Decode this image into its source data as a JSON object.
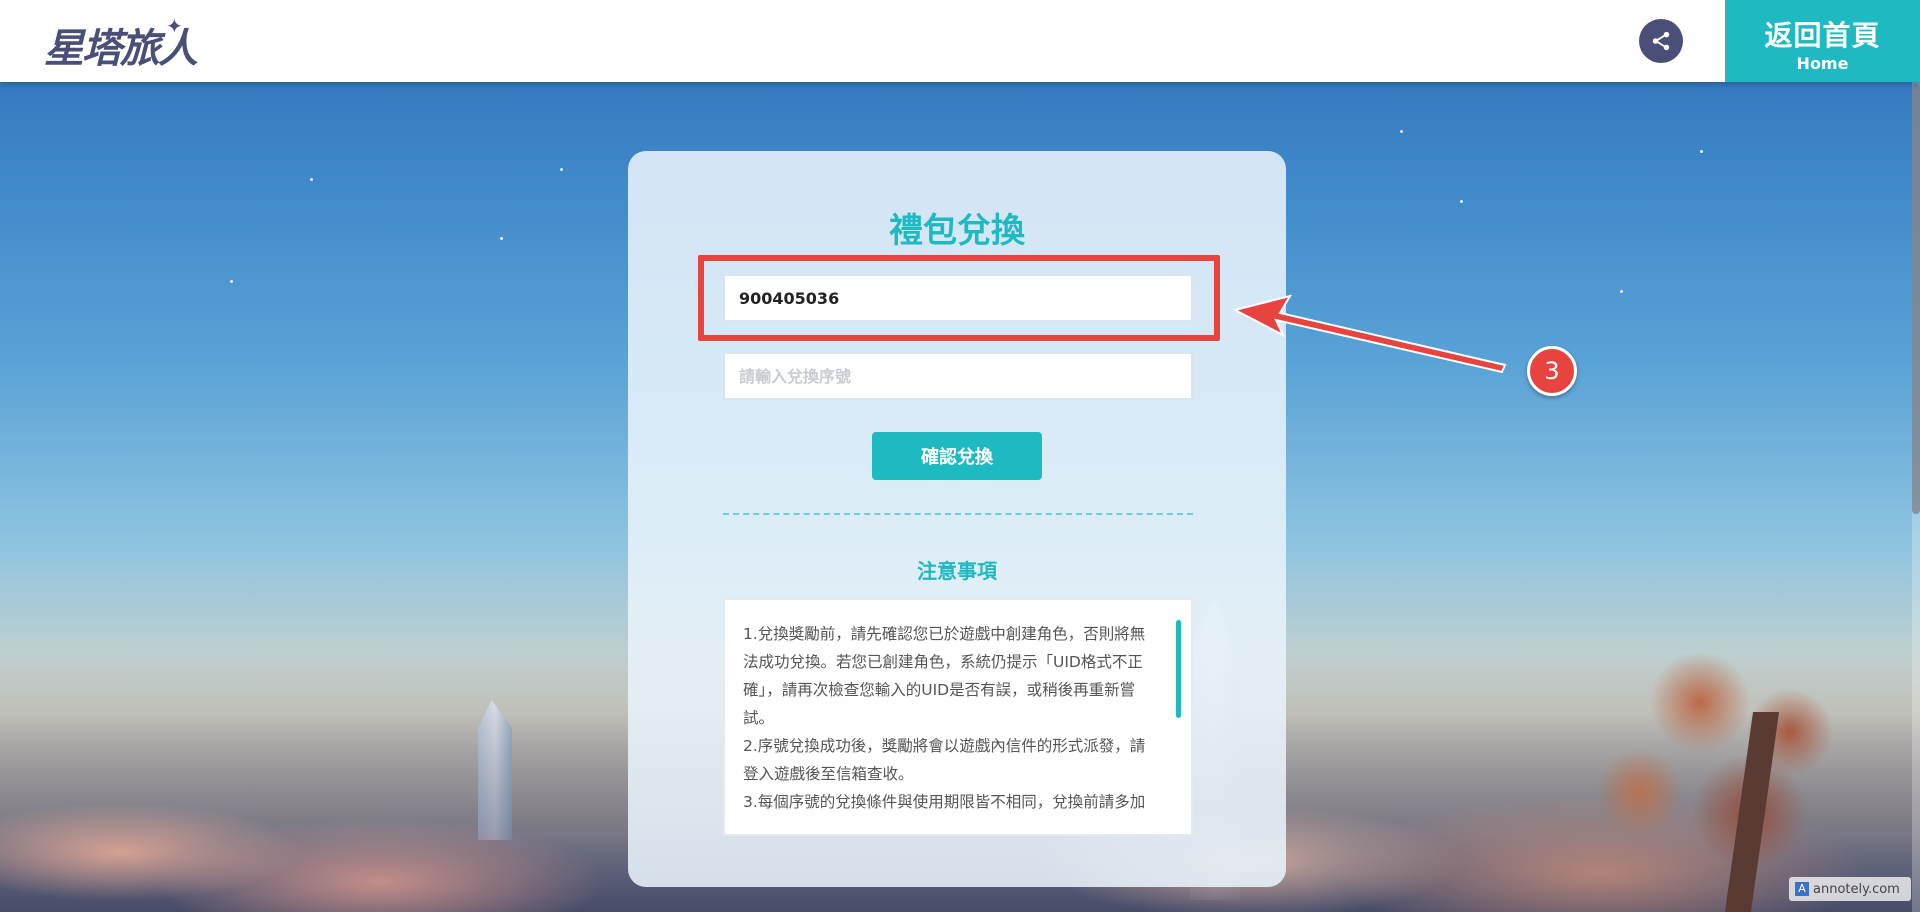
{
  "header": {
    "logo_text": "星塔旅人",
    "share_icon": "share-icon",
    "home_label": "返回首頁",
    "home_sublabel": "Home"
  },
  "card": {
    "title": "禮包兌換",
    "uid_value": "900405036",
    "code_placeholder": "請輸入兌換序號",
    "submit_label": "確認兌換",
    "notes_title": "注意事項",
    "notes": [
      "1.兌換獎勵前，請先確認您已於遊戲中創建角色，否則將無法成功兌換。若您已創建角色，系統仍提示「UID格式不正確」，請再次檢查您輸入的UID是否有誤，或稍後再重新嘗試。",
      "2.序號兌換成功後，獎勵將會以遊戲內信件的形式派發，請登入遊戲後至信箱查收。",
      "3.每個序號的兌換條件與使用期限皆不相同，兌換前請多加"
    ]
  },
  "annotation": {
    "step_number": "3",
    "color": "#e8443f"
  },
  "watermark": "annotely.com",
  "colors": {
    "accent": "#1fb9c1",
    "brand": "#4a4f78"
  }
}
